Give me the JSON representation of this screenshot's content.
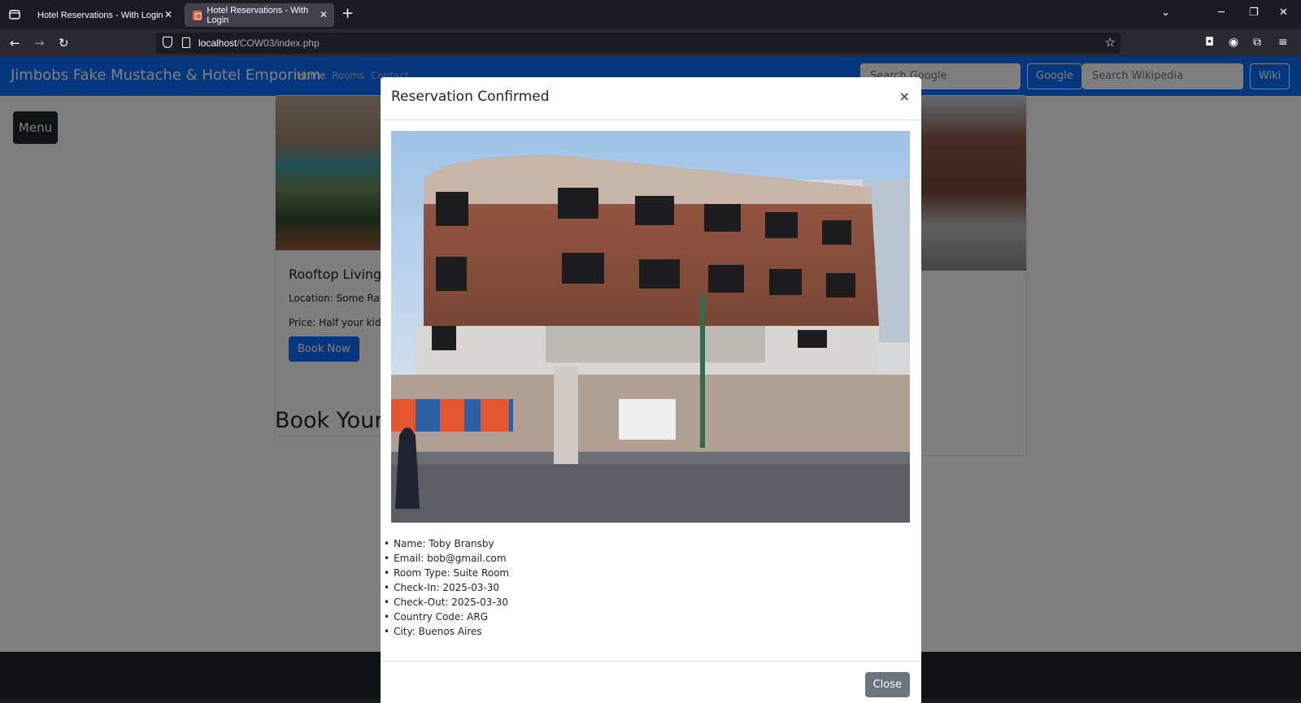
{
  "browser": {
    "tabs": [
      {
        "title": "Hotel Reservations - With Login"
      },
      {
        "title": "Hotel Reservations - With Login"
      }
    ],
    "url_host": "localhost",
    "url_path": "/COW03/index.php"
  },
  "site": {
    "brand": "Jimbobs Fake Mustache & Hotel Emporium",
    "nav": [
      "Home",
      "Rooms",
      "Contact"
    ],
    "search_google_placeholder": "Search Google",
    "google_button": "Google",
    "search_wiki_placeholder": "Search Wikipedia",
    "wiki_button": "Wiki",
    "menu_button": "Menu"
  },
  "card": {
    "title": "Rooftop Living",
    "location": "Location: Some Rand",
    "price": "Price: Half your kidn",
    "book_button": "Book Now"
  },
  "section_heading": "Book Your",
  "modal": {
    "title": "Reservation Confirmed",
    "close_x": "×",
    "details": [
      "Name: Toby Bransby",
      "Email: bob@gmail.com",
      "Room Type: Suite Room",
      "Check-In: 2025-03-30",
      "Check-Out: 2025-03-30",
      "Country Code: ARG",
      "City: Buenos Aires"
    ],
    "close_button": "Close"
  },
  "colors": {
    "primary": "#0d6efd",
    "dark": "#212529",
    "secondary": "#6c757d"
  }
}
